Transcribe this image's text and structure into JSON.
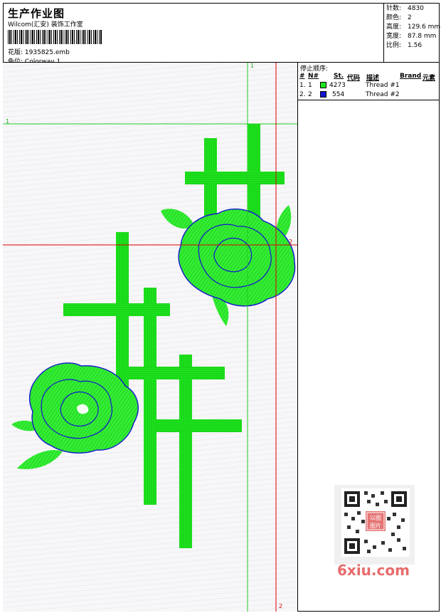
{
  "header": {
    "title": "生产作业图",
    "company": "Wilcom(汇安) 装饰工作室",
    "file_label": "花版:",
    "file_value": "1935825.emb",
    "colorway_label": "色位:",
    "colorway_value": "Colorway 1"
  },
  "stats": [
    {
      "label": "针数:",
      "value": "4830"
    },
    {
      "label": "颜色:",
      "value": "2"
    },
    {
      "label": "高度:",
      "value": "129.6 mm"
    },
    {
      "label": "宽度:",
      "value": "87.8 mm"
    },
    {
      "label": "比例:",
      "value": "1.56"
    }
  ],
  "stop_sequence": {
    "title": "停止顺序:",
    "headers": {
      "num": "#",
      "needle": "N#",
      "st": "St.",
      "code": "代码",
      "desc": "描述",
      "brand": "Brand",
      "element": "元素"
    },
    "rows": [
      {
        "num": "1.",
        "needle": "1",
        "color": "#1ee61e",
        "code": "4273",
        "desc": "Thread #1"
      },
      {
        "num": "2.",
        "needle": "2",
        "color": "#1414d2",
        "code": "554",
        "desc": "Thread #2"
      }
    ]
  },
  "guides": {
    "green_label": "1",
    "red_label": "2"
  },
  "watermark": {
    "site": "6xiu.com",
    "stamp": "以图图片"
  },
  "colors": {
    "green_thread": "#1ee61e",
    "blue_thread": "#1414d2",
    "guide_green": "#22cc22",
    "guide_red": "#dd0000"
  }
}
